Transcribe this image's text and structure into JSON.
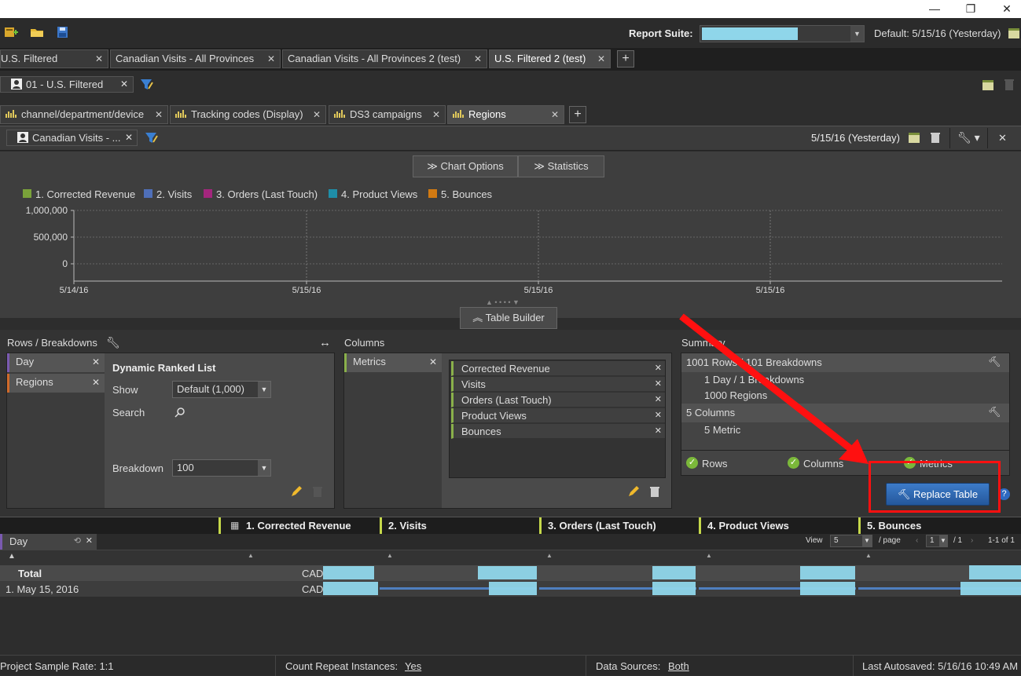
{
  "window": {
    "minimize": "—",
    "restore": "❐",
    "close": "✕"
  },
  "toolbar": {
    "report_suite_label": "Report Suite:",
    "default_text": "Default: 5/15/16 (Yesterday)"
  },
  "top_tabs": [
    {
      "label": "U.S. Filtered"
    },
    {
      "label": "Canadian Visits - All Provinces"
    },
    {
      "label": "Canadian Visits - All Provinces 2 (test)"
    },
    {
      "label": "U.S. Filtered 2 (test)"
    }
  ],
  "segment_chip": {
    "label": "01 - U.S. Filtered"
  },
  "report_tabs": [
    {
      "label": "channel/department/device"
    },
    {
      "label": "Tracking codes (Display)"
    },
    {
      "label": "DS3 campaigns"
    },
    {
      "label": "Regions"
    }
  ],
  "panel": {
    "segment": "Canadian Visits - ...",
    "date": "5/15/16 (Yesterday)"
  },
  "chart_buttons": {
    "chart_options": "Chart Options",
    "statistics": "Statistics"
  },
  "chart_data": {
    "type": "line",
    "series": [
      {
        "name": "1. Corrected Revenue",
        "color": "#7aa23a"
      },
      {
        "name": "2. Visits",
        "color": "#4f6fb8"
      },
      {
        "name": "3. Orders (Last Touch)",
        "color": "#a3267d"
      },
      {
        "name": "4. Product Views",
        "color": "#1f8ea8"
      },
      {
        "name": "5. Bounces",
        "color": "#d27a12"
      }
    ],
    "y_ticks": [
      "1,000,000",
      "500,000",
      "0"
    ],
    "x_ticks": [
      "5/14/16",
      "5/15/16",
      "5/15/16",
      "5/15/16"
    ],
    "grid": true
  },
  "table_builder_button": "Table Builder",
  "rows_section": {
    "title": "Rows / Breakdowns",
    "items": [
      "Day",
      "Regions"
    ],
    "dynamic_title": "Dynamic Ranked List",
    "show_label": "Show",
    "show_value": "Default (1,000)",
    "search_label": "Search",
    "breakdown_label": "Breakdown",
    "breakdown_value": "100"
  },
  "columns_section": {
    "title": "Columns",
    "header_item": "Metrics",
    "metrics": [
      "Corrected Revenue",
      "Visits",
      "Orders (Last Touch)",
      "Product Views",
      "Bounces"
    ]
  },
  "summary": {
    "title": "Summary",
    "line1": "1001 Rows / 101 Breakdowns",
    "line1a": "1 Day / 1 Breakdowns",
    "line1b": "1000 Regions",
    "line2": "5 Columns",
    "line2a": "5 Metric",
    "check_rows": "Rows",
    "check_columns": "Columns",
    "check_metrics": "Metrics",
    "replace_button": "Replace Table"
  },
  "table": {
    "columns": [
      "1. Corrected Revenue",
      "2. Visits",
      "3. Orders (Last Touch)",
      "4. Product Views",
      "5. Bounces"
    ],
    "row_dim": "Day",
    "view_label": "View",
    "view_value": "5",
    "per_page": "/ page",
    "page_value": "1",
    "page_total": "/ 1",
    "range": "1-1 of 1",
    "total_label": "Total",
    "row1_label": "1.  May 15, 2016",
    "currency": "CAD"
  },
  "status": {
    "sample_rate": "Project Sample Rate: 1:1",
    "count_repeat_label": "Count Repeat Instances:",
    "count_repeat_value": "Yes",
    "data_sources_label": "Data Sources:",
    "data_sources_value": "Both",
    "last_autosaved": "Last Autosaved: 5/16/16 10:49 AM"
  }
}
